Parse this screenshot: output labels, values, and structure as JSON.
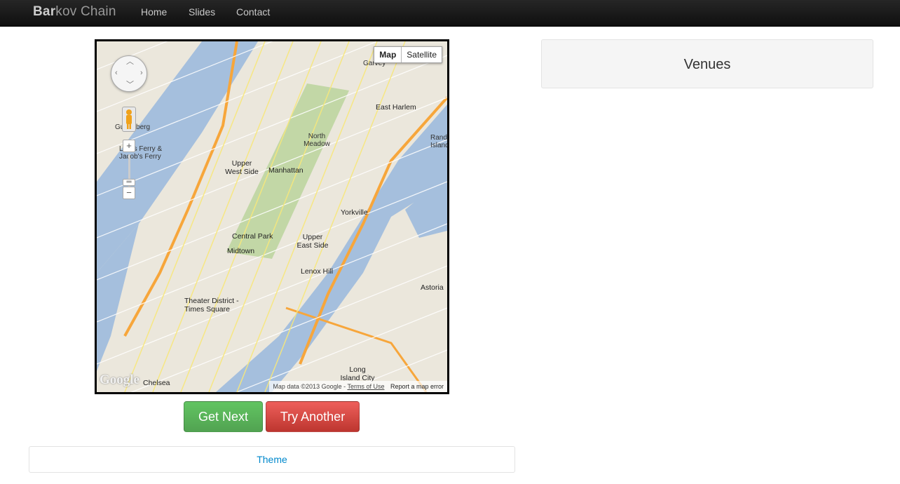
{
  "navbar": {
    "brand_bold": "Bar",
    "brand_rest": "kov Chain",
    "links": [
      "Home",
      "Slides",
      "Contact"
    ]
  },
  "map": {
    "type_options": [
      "Map",
      "Satellite"
    ],
    "selected_type": "Map",
    "zoom_in": "+",
    "zoom_out": "−",
    "logo": "Google",
    "attribution": "Map data ©2013 Google - ",
    "terms": "Terms of Use",
    "report": "Report a map error",
    "labels": [
      "Garvey",
      "East Harlem",
      "North Meadow",
      "Manhattan",
      "Upper West Side",
      "Yorkville",
      "Central Park",
      "Upper East Side",
      "Midtown",
      "Lenox Hill",
      "Theater District - Times Square",
      "Astoria",
      "Long Island City",
      "Chelsea",
      "Guttenberg",
      "Lewis Ferry & Jacob's Ferry",
      "Randall's Island"
    ],
    "colors": {
      "water": "#a5bfdd",
      "park": "#c2d7a6",
      "land": "#ebe7dc",
      "highway": "#f7a63b"
    }
  },
  "buttons": {
    "next": "Get Next",
    "try": "Try Another"
  },
  "theme": {
    "label": "Theme"
  },
  "venues": {
    "title": "Venues"
  }
}
